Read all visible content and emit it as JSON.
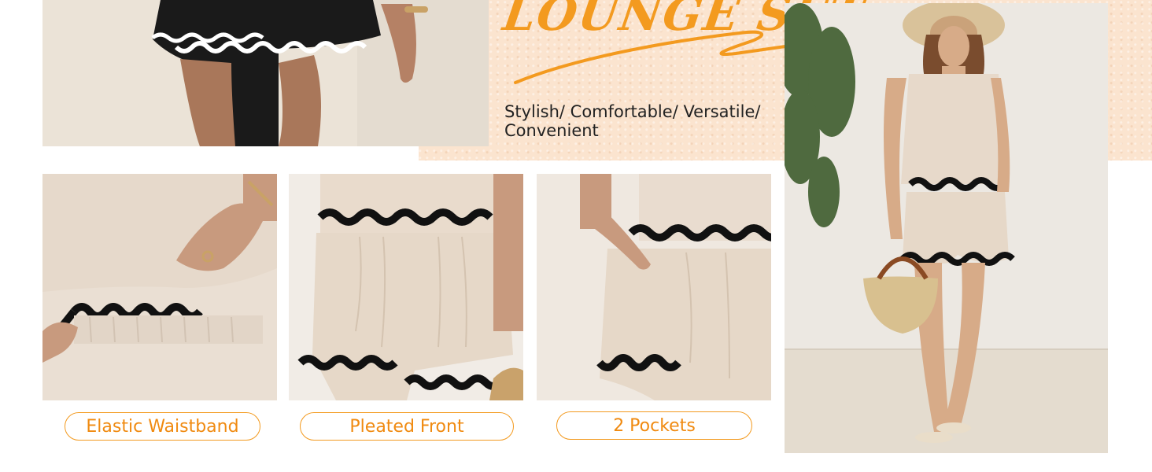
{
  "banner": {
    "title": "LOUNGE SET",
    "tagline": "Stylish/ Comfortable/ Versatile/ Convenient"
  },
  "features": [
    {
      "label": "Elastic Waistband"
    },
    {
      "label": "Pleated Front"
    },
    {
      "label": "2 Pockets"
    }
  ],
  "colors": {
    "accent": "#f39a1f",
    "banner_bg": "#fbe4cf",
    "fabric": "#e9dccf",
    "trim": "#111111"
  }
}
